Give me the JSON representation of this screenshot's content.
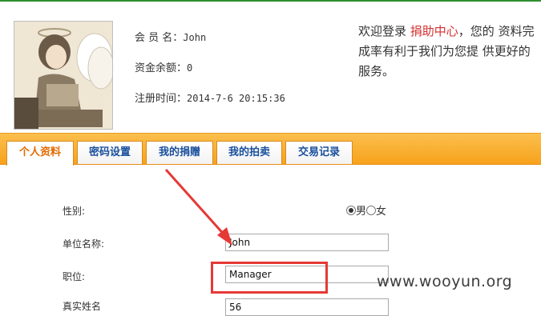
{
  "profile": {
    "member_label": "会 员 名：",
    "member_value": "John",
    "balance_label": "资金余额：",
    "balance_value": "0",
    "regtime_label": "注册时间：",
    "regtime_value": "2014-7-6 20:15:36"
  },
  "welcome": {
    "prefix": "欢迎登录 ",
    "highlight": "捐助中心",
    "suffix": "，您的 资料完成率有利于我们为您提 供更好的服务。"
  },
  "tabs": [
    {
      "label": "个人资料",
      "active": true
    },
    {
      "label": "密码设置",
      "active": false
    },
    {
      "label": "我的捐赠",
      "active": false
    },
    {
      "label": "我的拍卖",
      "active": false
    },
    {
      "label": "交易记录",
      "active": false
    }
  ],
  "form": {
    "gender_label": "性别:",
    "gender_options": [
      "男",
      "女"
    ],
    "gender_selected": "男",
    "company_label": "单位名称:",
    "company_value": "John",
    "position_label": "职位:",
    "position_value": "Manager",
    "realname_label": "真实姓名",
    "realname_value": "56"
  },
  "watermark": "www.wooyun.org",
  "colors": {
    "tab_bar": "#f7a21b",
    "active_tab_text": "#e36a00",
    "tab_text": "#1a4f9c",
    "highlight": "#d32f2f",
    "annotation": "#e53935"
  }
}
